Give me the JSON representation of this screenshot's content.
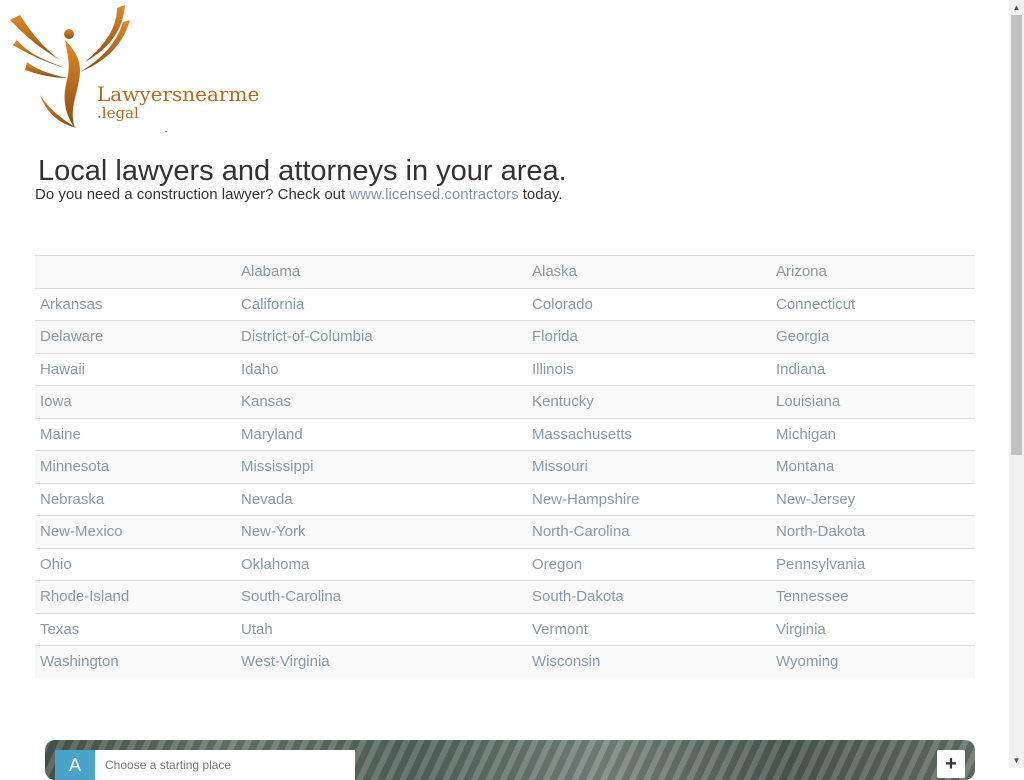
{
  "brand": {
    "logo_line1": "Lawyersnearme",
    "logo_line2": ".legal",
    "accent_color": "#b86a1e"
  },
  "header": {
    "title": "Local lawyers and attorneys in your area.",
    "intro_before": "Do you need a construction lawyer? Check out ",
    "intro_link": "www.licensed.contractors",
    "intro_after": " today."
  },
  "states_table": {
    "rows": [
      [
        "",
        "Alabama",
        "Alaska",
        "Arizona"
      ],
      [
        "Arkansas",
        "California",
        "Colorado",
        "Connecticut"
      ],
      [
        "Delaware",
        "District-of-Columbia",
        "Florida",
        "Georgia"
      ],
      [
        "Hawaii",
        "Idaho",
        "Illinois",
        "Indiana"
      ],
      [
        "Iowa",
        "Kansas",
        "Kentucky",
        "Louisiana"
      ],
      [
        "Maine",
        "Maryland",
        "Massachusetts",
        "Michigan"
      ],
      [
        "Minnesota",
        "Mississippi",
        "Missouri",
        "Montana"
      ],
      [
        "Nebraska",
        "Nevada",
        "New-Hampshire",
        "New-Jersey"
      ],
      [
        "New-Mexico",
        "New-York",
        "North-Carolina",
        "North-Dakota"
      ],
      [
        "Ohio",
        "Oklahoma",
        "Oregon",
        "Pennsylvania"
      ],
      [
        "Rhode-Island",
        "South-Carolina",
        "South-Dakota",
        "Tennessee"
      ],
      [
        "Texas",
        "Utah",
        "Vermont",
        "Virginia"
      ],
      [
        "Washington",
        "West-Virginia",
        "Wisconsin",
        "Wyoming"
      ]
    ],
    "link_color": "#8a9aa6"
  },
  "map": {
    "marker_label": "A",
    "start_placeholder": "Choose a starting place",
    "zoom_in_label": "+"
  },
  "scrollbar": {
    "up_icon": "arrow-up-icon",
    "down_icon": "arrow-down-icon"
  }
}
